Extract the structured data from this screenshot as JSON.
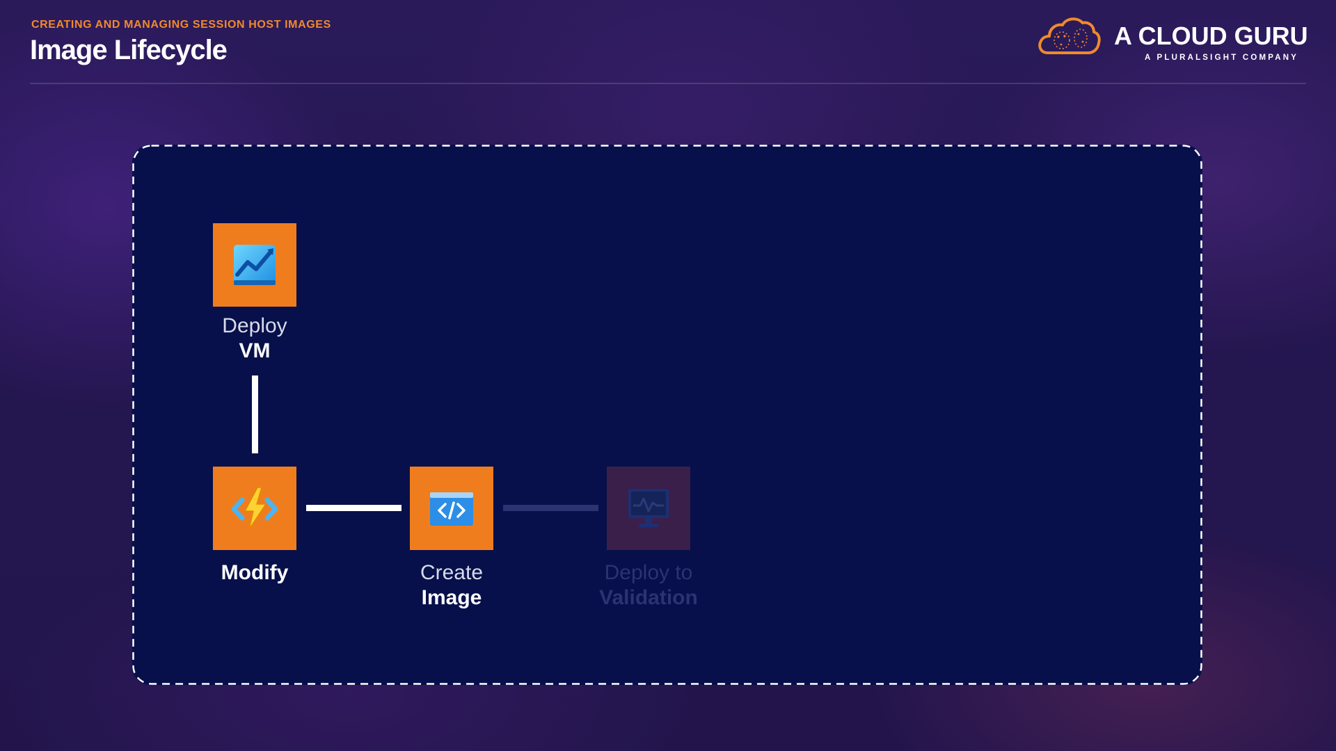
{
  "header": {
    "eyebrow": "CREATING AND MANAGING SESSION HOST IMAGES",
    "title": "Image Lifecycle"
  },
  "logo": {
    "name": "A CLOUD GURU",
    "tagline": "A PLURALSIGHT COMPANY",
    "icon": "cloud-icon",
    "color": "#f08a2c"
  },
  "diagram": {
    "accent_color": "#f07d1d",
    "panel_color": "#07104a",
    "nodes": [
      {
        "id": "deploy-vm",
        "icon": "chart-monitor-icon",
        "line1": "Deploy",
        "line2": "VM",
        "state": "active"
      },
      {
        "id": "modify",
        "icon": "lightning-code-icon",
        "line1": "",
        "line2": "Modify",
        "state": "active"
      },
      {
        "id": "create-image",
        "icon": "code-window-icon",
        "line1": "Create",
        "line2": "Image",
        "state": "active"
      },
      {
        "id": "deploy-validation",
        "icon": "monitor-pulse-icon",
        "line1": "Deploy to",
        "line2": "Validation",
        "state": "dimmed"
      }
    ],
    "connectors": [
      {
        "from": "deploy-vm",
        "to": "modify",
        "state": "active"
      },
      {
        "from": "modify",
        "to": "create-image",
        "state": "active"
      },
      {
        "from": "create-image",
        "to": "deploy-validation",
        "state": "dimmed"
      }
    ]
  }
}
